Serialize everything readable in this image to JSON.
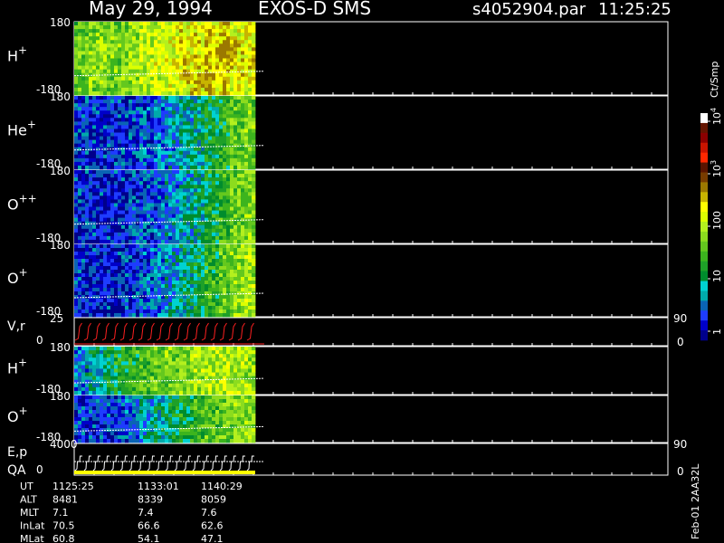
{
  "header": {
    "date": "May 29, 1994",
    "mission": "EXOS-D SMS",
    "file": "s4052904.par",
    "time": "11:25:25"
  },
  "colorbar": {
    "units_label": "Ct/Smp",
    "tick_labels": [
      "1",
      "10",
      "100",
      "10",
      "10"
    ],
    "tick_exponents": [
      "",
      "",
      "",
      "3",
      "4"
    ],
    "colors": [
      "#00008b",
      "#0000c8",
      "#1e3cff",
      "#0a64b4",
      "#00aaaa",
      "#00d2d2",
      "#008c2d",
      "#1ea028",
      "#3cb41e",
      "#64c81e",
      "#8cdc1e",
      "#b4f01e",
      "#dcff00",
      "#ffff00",
      "#c8b400",
      "#9b7800",
      "#783c00",
      "#5a1400",
      "#ff2800",
      "#c81400",
      "#8b0000",
      "#641400",
      "#ffffff"
    ]
  },
  "footer_label": "Feb-01 2AA32L",
  "chart_data": [
    {
      "type": "heatmap",
      "panel": "H+",
      "ylabel": "H",
      "ylabel_sup": "+",
      "yticks": [
        "180",
        "-180"
      ],
      "filled_fraction": 0.315,
      "intensity_profile": [
        0.55,
        0.62,
        0.6,
        0.58,
        0.65,
        0.7,
        0.72,
        0.75,
        0.8,
        0.82,
        0.85,
        0.88,
        0.8,
        0.78
      ]
    },
    {
      "type": "heatmap",
      "panel": "He+",
      "ylabel": "He",
      "ylabel_sup": "+",
      "yticks": [
        "180",
        "-180"
      ],
      "filled_fraction": 0.315,
      "intensity_profile": [
        0.15,
        0.12,
        0.12,
        0.14,
        0.15,
        0.18,
        0.22,
        0.26,
        0.3,
        0.35,
        0.42,
        0.5,
        0.58,
        0.62
      ]
    },
    {
      "type": "heatmap",
      "panel": "O++",
      "ylabel": "O",
      "ylabel_sup": "++",
      "yticks": [
        "180",
        "-180"
      ],
      "filled_fraction": 0.315,
      "intensity_profile": [
        0.14,
        0.12,
        0.12,
        0.12,
        0.14,
        0.16,
        0.2,
        0.25,
        0.3,
        0.36,
        0.44,
        0.52,
        0.6,
        0.64
      ]
    },
    {
      "type": "heatmap",
      "panel": "O+",
      "ylabel": "O",
      "ylabel_sup": "+",
      "yticks": [
        "180",
        "-180"
      ],
      "filled_fraction": 0.315,
      "intensity_profile": [
        0.14,
        0.12,
        0.12,
        0.12,
        0.14,
        0.18,
        0.22,
        0.28,
        0.34,
        0.42,
        0.5,
        0.58,
        0.64,
        0.68
      ]
    },
    {
      "type": "line",
      "panel": "V,r",
      "ylabel": "V,r",
      "yticks": [
        "25",
        "0"
      ],
      "right_ticks": [
        "90",
        "0"
      ],
      "sweeps": 20
    },
    {
      "type": "heatmap",
      "panel": "H+ (2)",
      "ylabel": "H",
      "ylabel_sup": "+",
      "yticks": [
        "180",
        "-180"
      ],
      "filled_fraction": 0.315,
      "intensity_profile": [
        0.25,
        0.35,
        0.4,
        0.45,
        0.5,
        0.55,
        0.6,
        0.62,
        0.65,
        0.68,
        0.7,
        0.72,
        0.7,
        0.68
      ]
    },
    {
      "type": "heatmap",
      "panel": "O+ (2)",
      "ylabel": "O",
      "ylabel_sup": "+",
      "yticks": [
        "180",
        "-180"
      ],
      "filled_fraction": 0.315,
      "intensity_profile": [
        0.15,
        0.14,
        0.15,
        0.18,
        0.22,
        0.28,
        0.34,
        0.4,
        0.46,
        0.52,
        0.56,
        0.6,
        0.62,
        0.64
      ]
    },
    {
      "type": "line",
      "panel": "E,p QA",
      "ylabel": "E,p",
      "ylabel2": "QA",
      "yticks": [
        "4000",
        "0"
      ],
      "right_ticks": [
        "90",
        "0"
      ],
      "sweeps": 20
    }
  ],
  "ephemeris": {
    "rows": [
      {
        "label": "UT",
        "values": [
          "1125:25",
          "1133:01",
          "1140:29"
        ]
      },
      {
        "label": "ALT",
        "values": [
          "8481",
          "8339",
          "8059"
        ]
      },
      {
        "label": "MLT",
        "values": [
          "7.1",
          "7.4",
          "7.6"
        ]
      },
      {
        "label": "InLat",
        "values": [
          "70.5",
          "66.6",
          "62.6"
        ]
      },
      {
        "label": "MLat",
        "values": [
          "60.8",
          "54.1",
          "47.1"
        ]
      }
    ]
  }
}
